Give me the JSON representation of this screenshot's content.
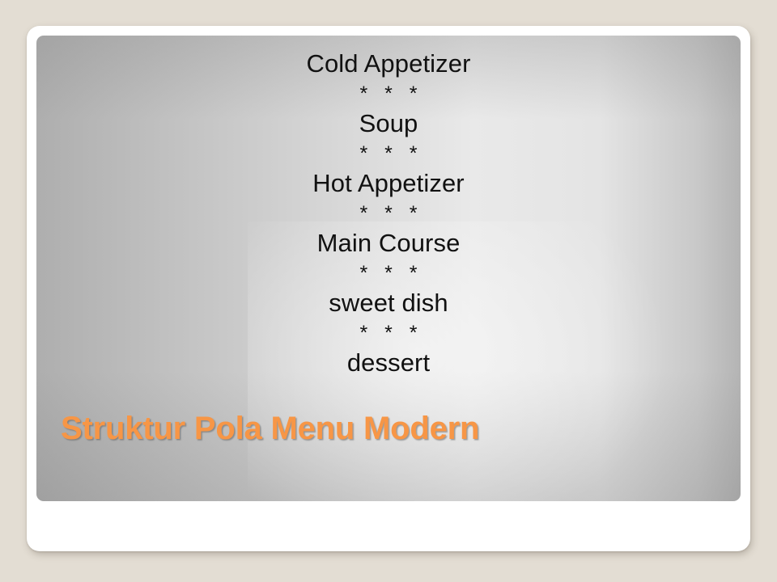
{
  "slide": {
    "title": "Struktur Pola Menu Modern",
    "title_color": "#F79646",
    "background_color": "#E3DDD3",
    "card_color": "#FFFFFF",
    "panel_gradient_from": "#AEAEAE",
    "panel_gradient_to": "#EAEAEA",
    "text_color": "#111111",
    "separator": "* * *",
    "menu": [
      {
        "course": "Cold Appetizer",
        "separator": "* * *"
      },
      {
        "course": "Soup",
        "separator": "* * *"
      },
      {
        "course": "Hot Appetizer",
        "separator": "* * *"
      },
      {
        "course": "Main Course",
        "separator": "* * *"
      },
      {
        "course": "sweet dish",
        "separator": "* * *"
      },
      {
        "course": "dessert",
        "separator": ""
      }
    ]
  }
}
